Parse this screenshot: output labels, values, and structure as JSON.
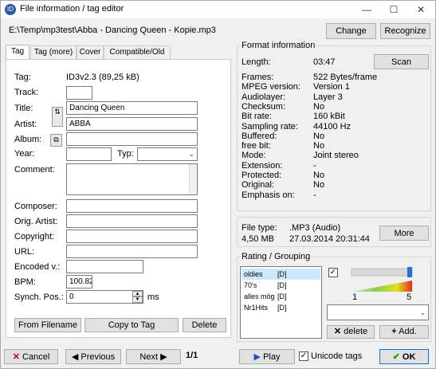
{
  "window": {
    "title": "File information / tag editor",
    "minimize_glyph": "—",
    "maximize_glyph": "☐",
    "close_glyph": "✕"
  },
  "path": "E:\\Temp\\mp3test\\Abba - Dancing Queen - Kopie.mp3",
  "top_buttons": {
    "change": "Change",
    "recognize": "Recognize"
  },
  "tabs": [
    "Tag",
    "Tag (more)",
    "Cover",
    "Compatible/Old Tag"
  ],
  "tag": {
    "tag_label": "Tag:",
    "tag_value": "ID3v2.3 (89,25 kB)",
    "track_label": "Track:",
    "track": "",
    "title_label": "Title:",
    "title": "Dancing Queen",
    "artist_label": "Artist:",
    "artist": "ABBA",
    "album_label": "Album:",
    "album": "",
    "year_label": "Year:",
    "year": "",
    "typ_label": "Typ:",
    "typ": "",
    "comment_label": "Comment:",
    "comment": "",
    "composer_label": "Composer:",
    "composer": "",
    "orig_artist_label": "Orig. Artist:",
    "orig_artist": "",
    "copyright_label": "Copyright:",
    "copyright": "",
    "url_label": "URL:",
    "url": "",
    "encoded_label": "Encoded v.:",
    "encoded": "",
    "bpm_label": "BPM:",
    "bpm": "100.82",
    "synch_label": "Synch. Pos.:",
    "synch": "0",
    "synch_unit": "ms"
  },
  "tag_buttons": {
    "from_filename": "From Filename",
    "copy_to_tag": "Copy to Tag",
    "delete": "Delete"
  },
  "format": {
    "group_title": "Format information",
    "scan": "Scan",
    "rows": [
      {
        "label": "Length:",
        "value": "03:47"
      },
      {
        "label": "Frames:",
        "value": "522 Bytes/frame"
      },
      {
        "label": "MPEG version:",
        "value": "Version 1"
      },
      {
        "label": "Audiolayer:",
        "value": "Layer 3"
      },
      {
        "label": "Checksum:",
        "value": "No"
      },
      {
        "label": "Bit rate:",
        "value": "160 kBit"
      },
      {
        "label": "Sampling rate:",
        "value": "44100 Hz"
      },
      {
        "label": "Buffered:",
        "value": "No"
      },
      {
        "label": "free bit:",
        "value": "No"
      },
      {
        "label": "Mode:",
        "value": "Joint stereo"
      },
      {
        "label": "Extension:",
        "value": "-"
      },
      {
        "label": "Protected:",
        "value": "No"
      },
      {
        "label": "Original:",
        "value": "No"
      },
      {
        "label": "Emphasis on:",
        "value": "-"
      }
    ]
  },
  "file": {
    "type_label": "File type:",
    "type_value": ".MP3 (Audio)",
    "size": "4,50 MB",
    "date": "27.03.2014 20:31:44",
    "more": "More"
  },
  "rating": {
    "group_title": "Rating / Grouping",
    "items": [
      {
        "name": "oldies",
        "tag": "[D]"
      },
      {
        "name": "70's",
        "tag": "[D]"
      },
      {
        "name": "alles mög",
        "tag": "[D]"
      },
      {
        "name": "Nr1Hits",
        "tag": "[D]"
      }
    ],
    "slider_min": "1",
    "slider_max": "5",
    "slider_value": 5,
    "delete": "delete",
    "add": "Add."
  },
  "bottom": {
    "cancel": "Cancel",
    "previous": "Previous",
    "next": "Next",
    "page": "1/1",
    "play": "Play",
    "unicode": "Unicode tags",
    "ok": "OK"
  },
  "colors": {
    "selection": "#cce8ff",
    "ok_check": "#1a9a1a",
    "cancel_x": "#c00000",
    "play": "#1f4fbf"
  }
}
